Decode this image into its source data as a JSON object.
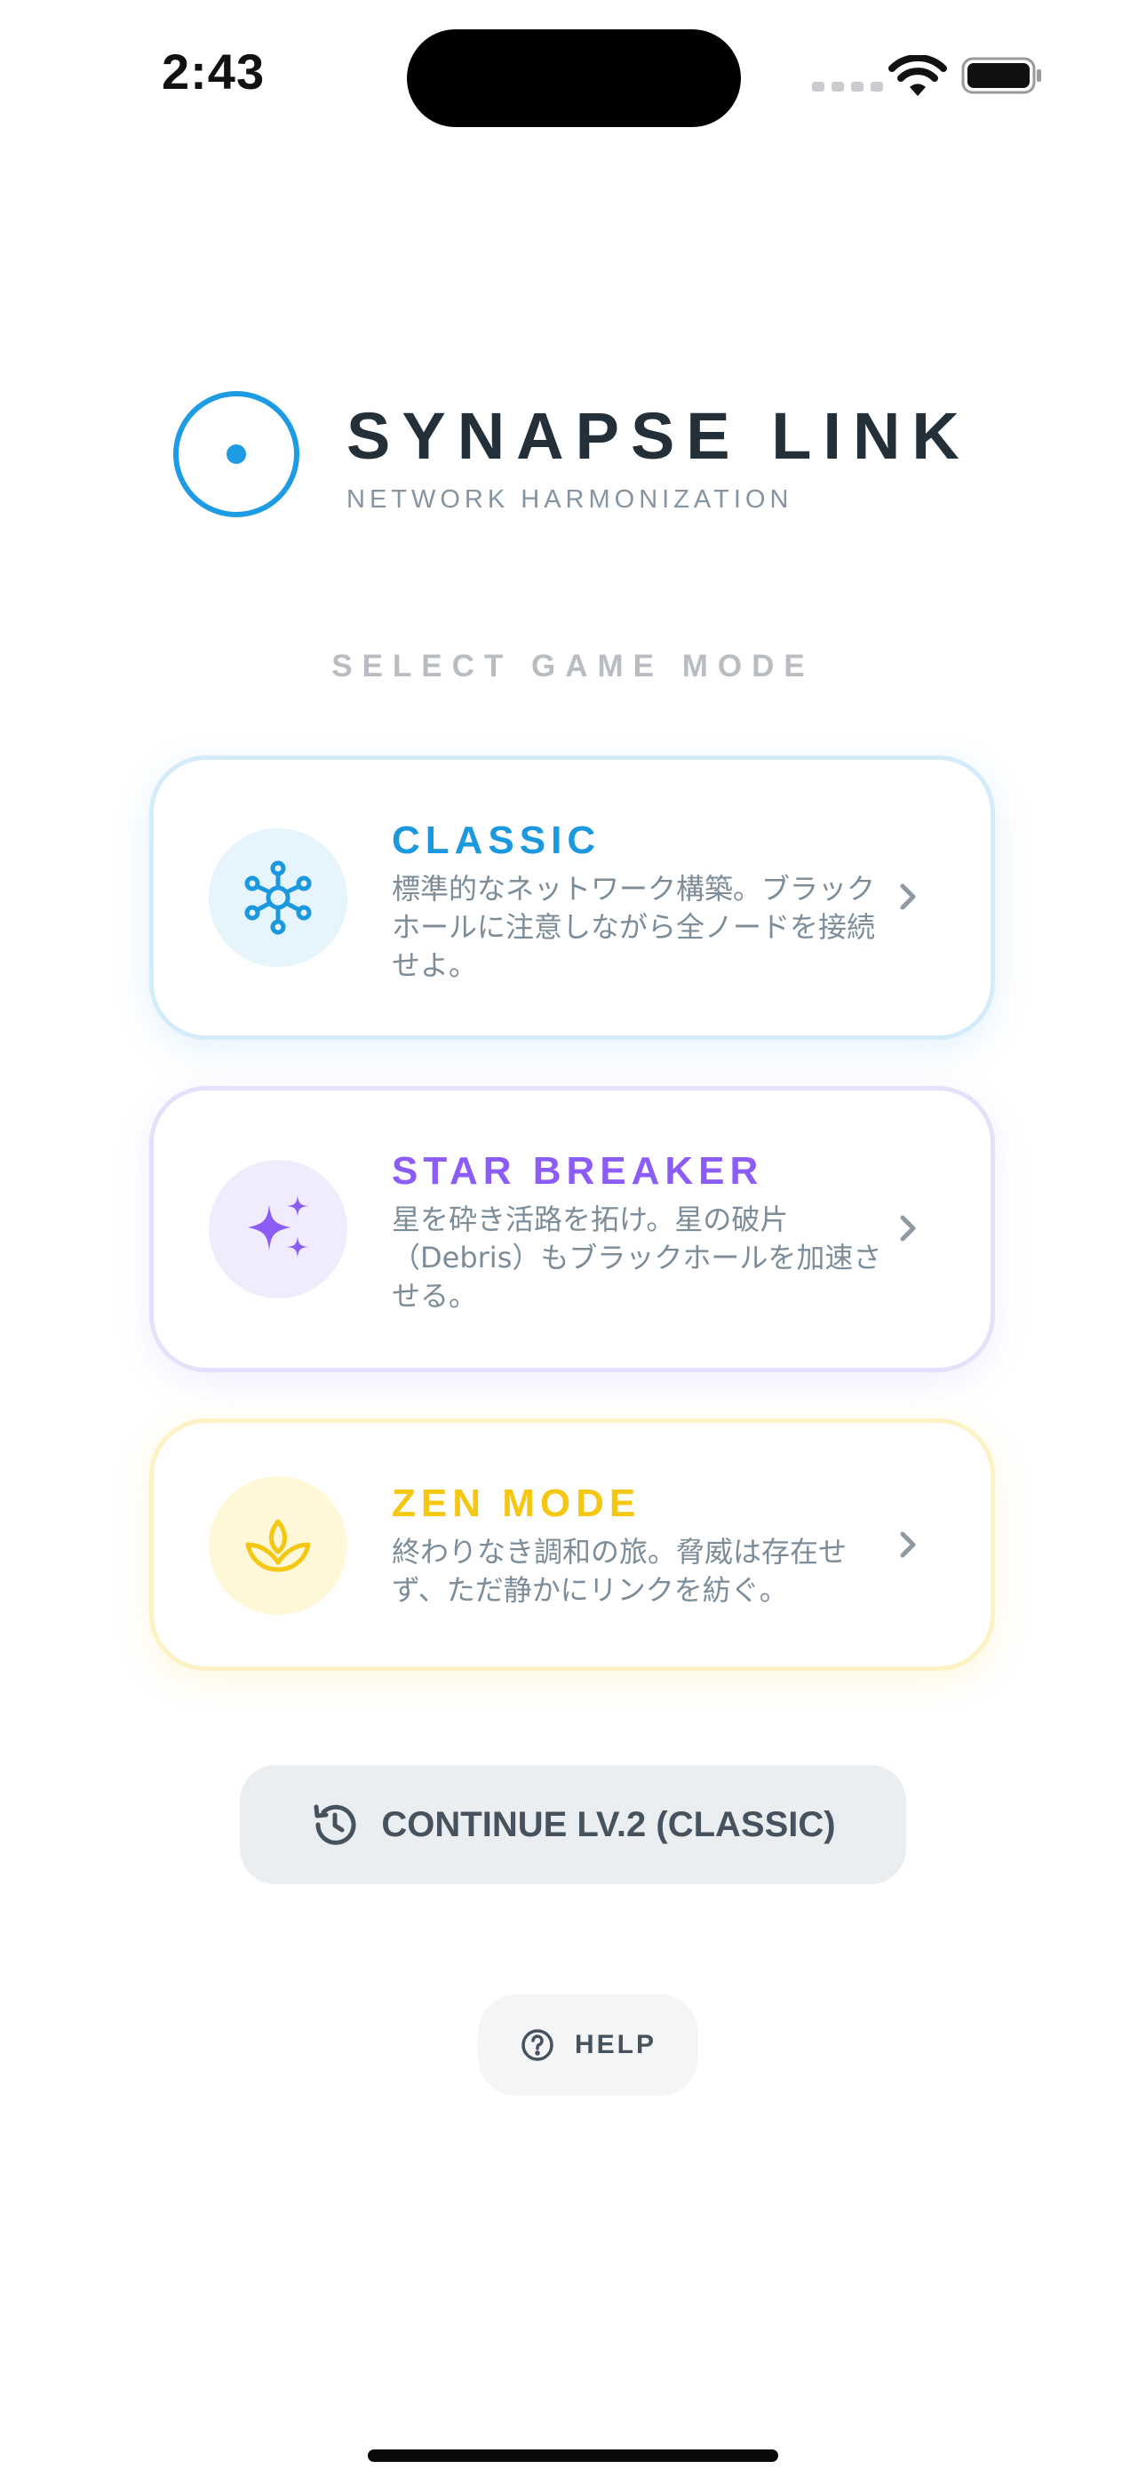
{
  "status_bar": {
    "time": "2:43"
  },
  "header": {
    "title": "SYNAPSE LINK",
    "subtitle": "NETWORK HARMONIZATION",
    "logo_icon": "target-dot-icon",
    "accent_color": "#1d9be3"
  },
  "mode_select": {
    "section_title": "SELECT GAME MODE",
    "modes": [
      {
        "name": "CLASSIC",
        "description": "標準的なネットワーク構築。ブラックホールに注意しながら全ノードを接続せよ。",
        "icon": "network-nodes-icon",
        "color": "#1c98df"
      },
      {
        "name": "STAR BREAKER",
        "description": "星を砕き活路を拓け。星の破片（Debris）もブラックホールを加速させる。",
        "icon": "sparkles-icon",
        "color": "#8b5cf6"
      },
      {
        "name": "ZEN MODE",
        "description": "終わりなき調和の旅。脅威は存在せず、ただ静かにリンクを紡ぐ。",
        "icon": "lotus-icon",
        "color": "#f5c712"
      }
    ]
  },
  "continue": {
    "label": "CONTINUE LV.2 (CLASSIC)",
    "icon": "history-icon"
  },
  "help": {
    "label": "HELP",
    "icon": "question-circle-icon"
  }
}
